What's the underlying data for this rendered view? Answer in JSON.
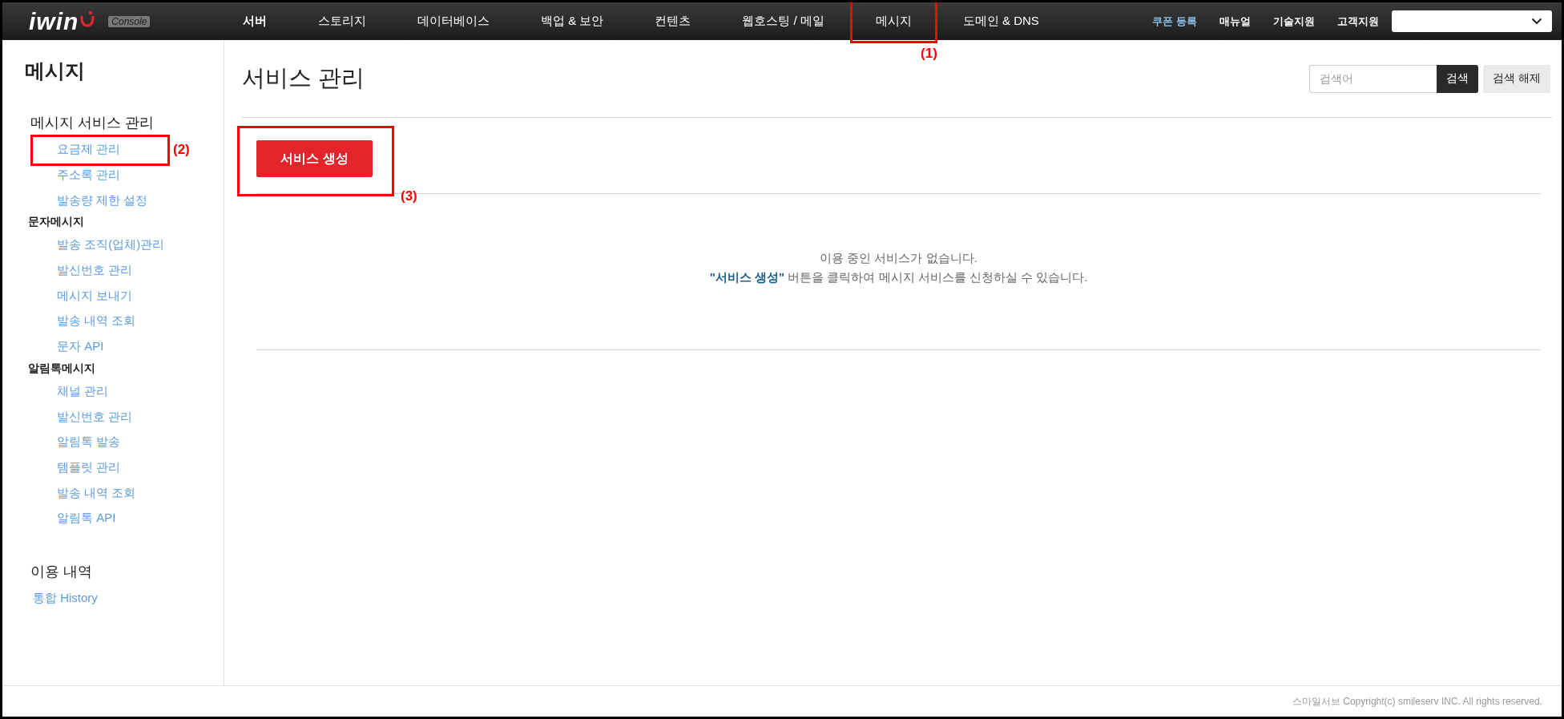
{
  "header": {
    "logo": {
      "text": "iwin",
      "badge": "Console"
    },
    "nav": [
      {
        "label": "서버"
      },
      {
        "label": "스토리지"
      },
      {
        "label": "데이터베이스"
      },
      {
        "label": "백업 & 보안"
      },
      {
        "label": "컨텐츠"
      },
      {
        "label": "웹호스팅 / 메일"
      },
      {
        "label": "메시지",
        "annotation": "(1)"
      },
      {
        "label": "도메인 & DNS"
      }
    ],
    "links": [
      {
        "label": "쿠폰 등록",
        "kind": "accent"
      },
      {
        "label": "매뉴얼",
        "kind": "plain"
      },
      {
        "label": "기술지원",
        "kind": "plain"
      },
      {
        "label": "고객지원",
        "kind": "plain"
      }
    ]
  },
  "sidebar": {
    "title": "메시지",
    "sections": [
      {
        "title": "메시지 서비스 관리",
        "groups": [
          {
            "items": [
              {
                "label": "요금제 관리",
                "annotation": "(2)"
              },
              {
                "label": "주소록 관리"
              },
              {
                "label": "발송량 제한 설정"
              }
            ]
          },
          {
            "title": "문자메시지",
            "items": [
              {
                "label": "발송 조직(업체)관리"
              },
              {
                "label": "발신번호 관리"
              },
              {
                "label": "메시지 보내기"
              },
              {
                "label": "발송 내역 조회"
              },
              {
                "label": "문자 API"
              }
            ]
          },
          {
            "title": "알림톡메시지",
            "items": [
              {
                "label": "채널 관리"
              },
              {
                "label": "발신번호 관리"
              },
              {
                "label": "알림톡 발송"
              },
              {
                "label": "템플릿 관리"
              },
              {
                "label": "발송 내역 조회"
              },
              {
                "label": "알림톡 API"
              }
            ]
          }
        ]
      },
      {
        "title": "이용 내역",
        "groups": [
          {
            "items": [
              {
                "label": "통합 History"
              }
            ]
          }
        ]
      }
    ]
  },
  "main": {
    "title": "서비스 관리",
    "search": {
      "placeholder": "검색어",
      "button": "검색",
      "reset": "검색 해제"
    },
    "create_button": {
      "label": "서비스 생성",
      "annotation": "(3)"
    },
    "empty_message": [
      "이용 중인 서비스가 없습니다.",
      "**\"서비스 생성\"** 버튼을 클릭하여 메시지 서비스를 신청하실 수 있습니다."
    ]
  },
  "footer": "스마일서브 Copyright(c) smileserv INC. All rights reserved."
}
